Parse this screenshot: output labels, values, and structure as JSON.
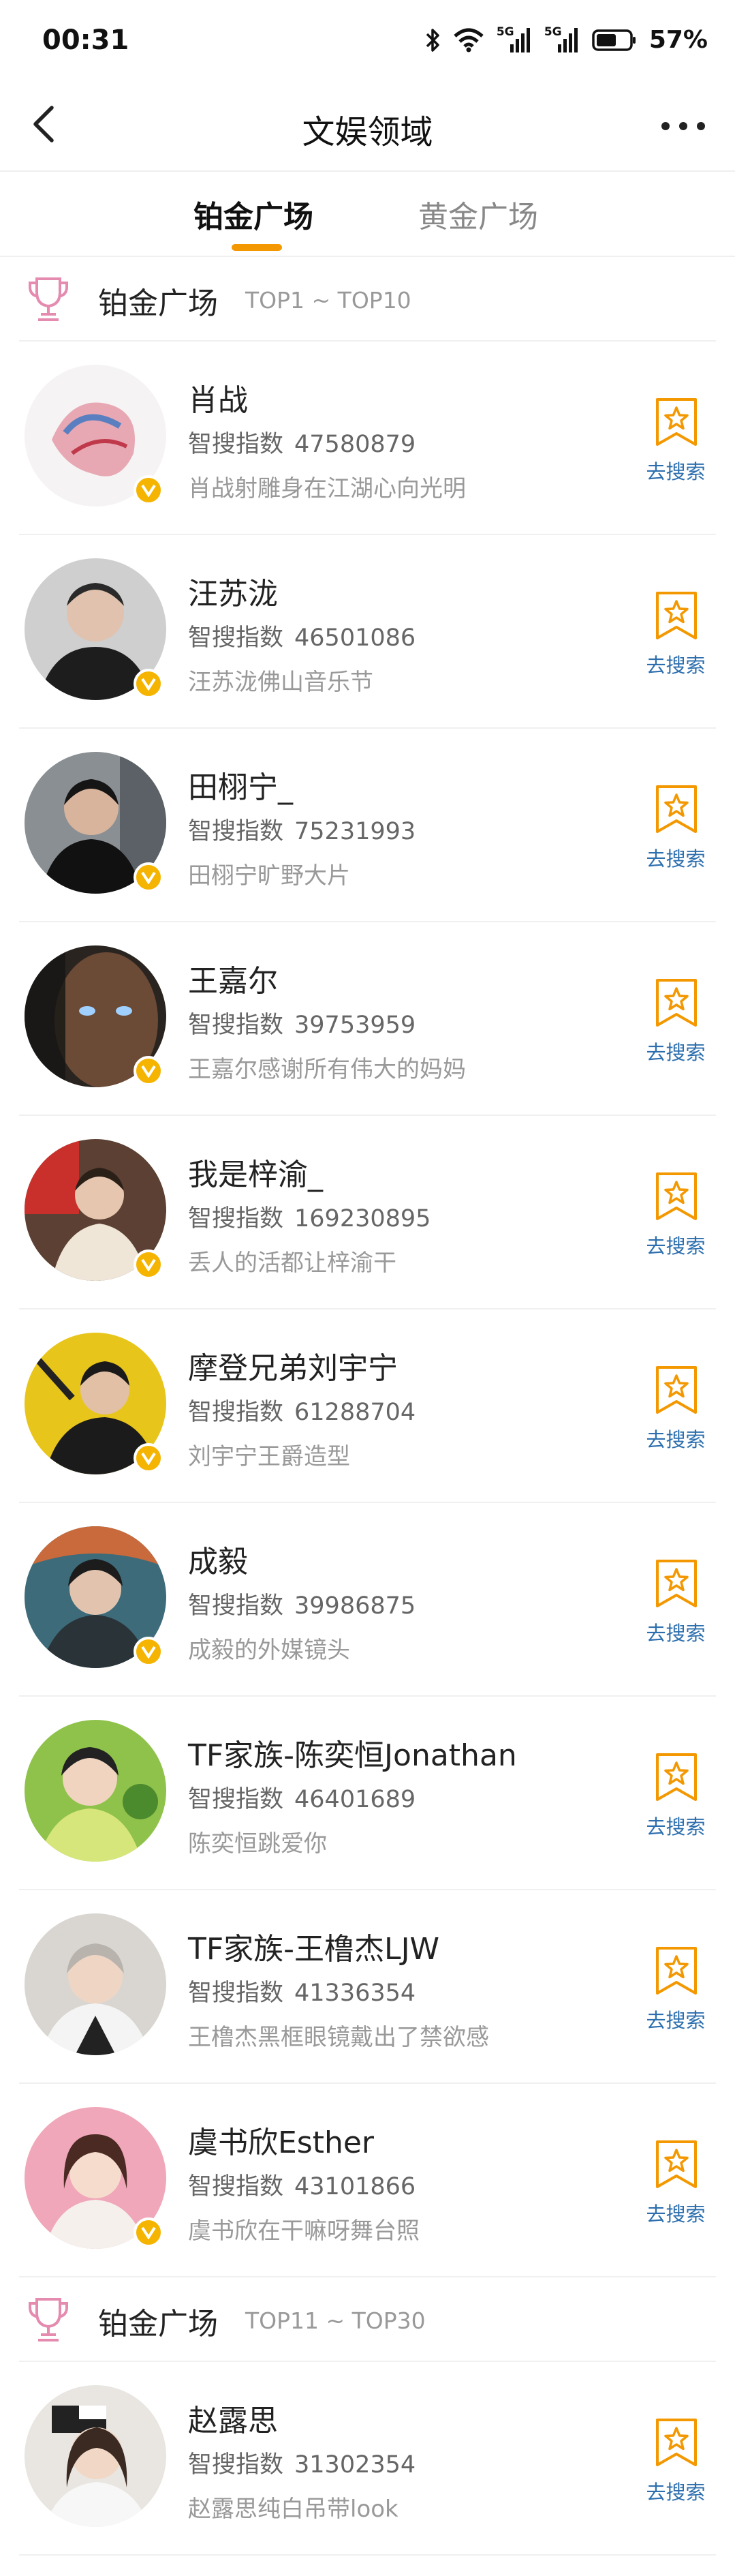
{
  "status_bar": {
    "time": "00:31",
    "network1": "5G",
    "network2": "5G",
    "battery": "57%"
  },
  "nav": {
    "title": "文娱领域"
  },
  "tabs": [
    {
      "label": "铂金广场"
    },
    {
      "label": "黄金广场"
    }
  ],
  "sections": [
    {
      "title": "铂金广场",
      "range": "TOP1 ~ TOP10"
    },
    {
      "title": "铂金广场",
      "range": "TOP11 ~ TOP30"
    }
  ],
  "index_label": "智搜指数",
  "search_label": "去搜索",
  "items": [
    {
      "name": "肖战",
      "index": "47580879",
      "desc": "肖战射雕身在江湖心向光明"
    },
    {
      "name": "汪苏泷",
      "index": "46501086",
      "desc": "汪苏泷佛山音乐节"
    },
    {
      "name": "田栩宁_",
      "index": "75231993",
      "desc": "田栩宁旷野大片"
    },
    {
      "name": "王嘉尔",
      "index": "39753959",
      "desc": "王嘉尔感谢所有伟大的妈妈"
    },
    {
      "name": "我是梓渝_",
      "index": "169230895",
      "desc": "丢人的活都让梓渝干"
    },
    {
      "name": "摩登兄弟刘宇宁",
      "index": "61288704",
      "desc": "刘宇宁王爵造型"
    },
    {
      "name": "成毅",
      "index": "39986875",
      "desc": "成毅的外媒镜头"
    },
    {
      "name": "TF家族-陈奕恒Jonathan",
      "index": "46401689",
      "desc": "陈奕恒跳爱你"
    },
    {
      "name": "TF家族-王橹杰LJW",
      "index": "41336354",
      "desc": "王橹杰黑框眼镜戴出了禁欲感"
    },
    {
      "name": "虞书欣Esther",
      "index": "43101866",
      "desc": "虞书欣在干嘛呀舞台照"
    },
    {
      "name": "赵露思",
      "index": "31302354",
      "desc": "赵露思纯白吊带look"
    }
  ],
  "colors": {
    "accent": "#f39800",
    "verified": "#f5b400",
    "link": "#2d6fae"
  }
}
